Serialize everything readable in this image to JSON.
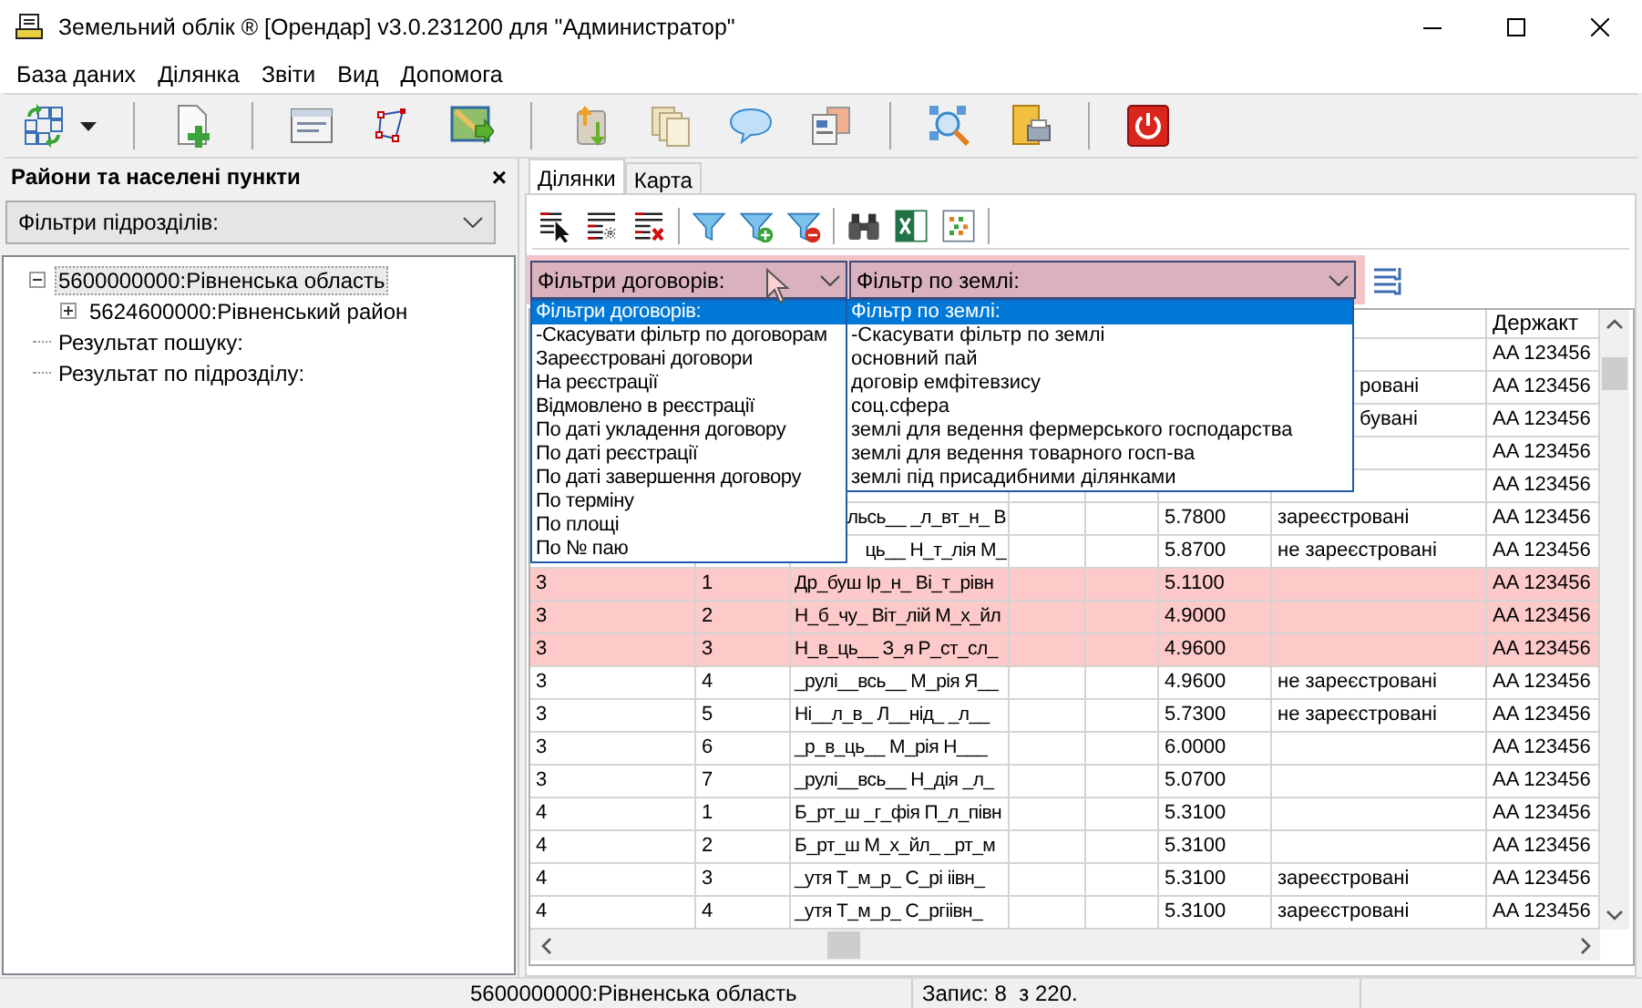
{
  "window": {
    "title": "Земельний облік ® [Орендар] v3.0.231200 для \"Администратор\""
  },
  "menu": [
    "База даних",
    "Ділянка",
    "Звіти",
    "Вид",
    "Допомога"
  ],
  "left_panel": {
    "title": "Райони та населені пункти",
    "close": "×",
    "filter": {
      "value": "Фільтри підрозділів:"
    },
    "tree": [
      {
        "label": "5600000000:Рівненська область",
        "kind": "group",
        "expanded": true,
        "selected": true,
        "children": [
          {
            "label": "5624600000:Рівненський район",
            "kind": "group",
            "expanded": false,
            "selected": false
          }
        ]
      },
      {
        "label": "Результат пошуку:",
        "kind": "result",
        "selected": false
      },
      {
        "label": "Результат по підрозділу:",
        "kind": "result",
        "selected": false
      }
    ]
  },
  "tabs": [
    {
      "label": "Ділянки",
      "selected": true
    },
    {
      "label": "Карта",
      "selected": false
    }
  ],
  "contract_filter": {
    "value": "Фільтри договорів:",
    "open": true,
    "options": [
      {
        "label": "Фільтри договорів:",
        "selected": true
      },
      {
        "label": "-Скасувати фільтр по договорам",
        "selected": false
      },
      {
        "label": "Зареєстровані договори",
        "selected": false
      },
      {
        "label": "На реєстрації",
        "selected": false
      },
      {
        "label": "Відмовлено в реєстрації",
        "selected": false
      },
      {
        "label": "По даті укладення договору",
        "selected": false
      },
      {
        "label": "По даті реєстрації",
        "selected": false
      },
      {
        "label": "По даті завершення договору",
        "selected": false
      },
      {
        "label": "По терміну",
        "selected": false
      },
      {
        "label": "По площі",
        "selected": false
      },
      {
        "label": "По № паю",
        "selected": false
      }
    ]
  },
  "land_filter": {
    "value": "Фільтр по землі:",
    "open": true,
    "options": [
      {
        "label": "Фільтр по землі:",
        "selected": true
      },
      {
        "label": "-Скасувати фільтр по землі",
        "selected": false
      },
      {
        "label": "основний пай",
        "selected": false
      },
      {
        "label": "договір емфітевзису",
        "selected": false
      },
      {
        "label": "соц.сфера",
        "selected": false
      },
      {
        "label": "землі для ведення фермерського господарства",
        "selected": false
      },
      {
        "label": "землі для ведення товарного госп-ва",
        "selected": false
      },
      {
        "label": "землі під присадибними ділянками",
        "selected": false
      }
    ]
  },
  "table": {
    "header": {
      "column_8": "Держакт"
    },
    "rows": [
      {
        "highlighted": false,
        "column_8": "AA 123456"
      },
      {
        "highlighted": false,
        "column_7": "ровані",
        "column_8": "AA 123456"
      },
      {
        "highlighted": false,
        "column_7": "бувані",
        "column_8": "AA 123456"
      },
      {
        "highlighted": false,
        "column_8": "AA 123456"
      },
      {
        "highlighted": false,
        "column_8": "AA 123456"
      },
      {
        "highlighted": false,
        "column_3": "льсь__ _л_вт_н_ В",
        "column_6": "5.7800",
        "column_7": "зареєстровані",
        "column_8": "AA 123456"
      },
      {
        "highlighted": false,
        "column_3": "ць__ Н_т_лія М_",
        "column_6": "5.8700",
        "column_7": "не зареєстровані",
        "column_8": "AA 123456"
      },
      {
        "highlighted": true,
        "column_1": "3",
        "column_2": "1",
        "column_3": "Др_буш Ір_н_ Ві_т_рівн",
        "column_6": "5.1100",
        "column_8": "AA 123456"
      },
      {
        "highlighted": true,
        "column_1": "3",
        "column_2": "2",
        "column_3": "Н_б_чу_ Віт_лій М_х_йл",
        "column_6": "4.9000",
        "column_8": "AA 123456"
      },
      {
        "highlighted": true,
        "column_1": "3",
        "column_2": "3",
        "column_3": "Н_в_ць__ З_я Р_ст_сл_",
        "column_6": "4.9600",
        "column_8": "AA 123456"
      },
      {
        "highlighted": false,
        "column_1": "3",
        "column_2": "4",
        "column_3": "_рулі__всь__ М_рія Я__",
        "column_6": "4.9600",
        "column_7": "не зареєстровані",
        "column_8": "AA 123456"
      },
      {
        "highlighted": false,
        "column_1": "3",
        "column_2": "5",
        "column_3": "Ні__л_в_ Л__нід_ _л__",
        "column_6": "5.7300",
        "column_7": "не зареєстровані",
        "column_8": "AA 123456"
      },
      {
        "highlighted": false,
        "column_1": "3",
        "column_2": "6",
        "column_3": "_р_в_ць__ М_рія Н___",
        "column_6": "6.0000",
        "column_8": "AA 123456"
      },
      {
        "highlighted": false,
        "column_1": "3",
        "column_2": "7",
        "column_3": "_рулі__всь__ Н_дія _л_",
        "column_6": "5.0700",
        "column_8": "AA 123456"
      },
      {
        "highlighted": false,
        "column_1": "4",
        "column_2": "1",
        "column_3": "Б_рт_ш _г_фія П_л_півн",
        "column_6": "5.3100",
        "column_8": "AA 123456"
      },
      {
        "highlighted": false,
        "column_1": "4",
        "column_2": "2",
        "column_3": "Б_рт_ш М_х_йл_ _рт_м",
        "column_6": "5.3100",
        "column_8": "AA 123456"
      },
      {
        "highlighted": false,
        "column_1": "4",
        "column_2": "3",
        "column_3": "_утя Т_м_р_ С_рі іівн_",
        "column_6": "5.3100",
        "column_7": "зареєстровані",
        "column_8": "AA 123456"
      },
      {
        "highlighted": false,
        "column_1": "4",
        "column_2": "4",
        "column_3": "_утя Т_м_р_ С_ргіівн_",
        "column_6": "5.3100",
        "column_7": "зареєстровані",
        "column_8": "AA 123456"
      }
    ]
  },
  "status_bar": {
    "region": "5600000000:Рівненська область",
    "record": "Запис: 8  з 220."
  }
}
